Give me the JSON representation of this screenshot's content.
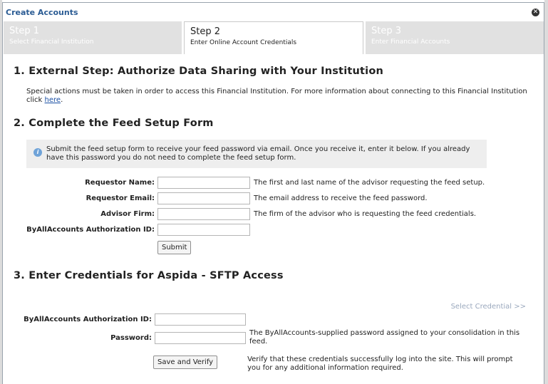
{
  "dialog": {
    "title": "Create Accounts"
  },
  "steps": [
    {
      "num": "Step 1",
      "desc": "Select Financial Institution",
      "active": false
    },
    {
      "num": "Step 2",
      "desc": "Enter Online Account Credentials",
      "active": true
    },
    {
      "num": "Step 3",
      "desc": "Enter Financial Accounts",
      "active": false
    }
  ],
  "section1": {
    "heading": "1. External Step: Authorize Data Sharing with Your Institution",
    "text": "Special actions must be taken in order to access this Financial Institution. For more information about connecting to this Financial Institution click ",
    "link": "here",
    "text_end": "."
  },
  "section2": {
    "heading": "2. Complete the Feed Setup Form",
    "info": "Submit the feed setup form to receive your feed password via email. Once you receive it, enter it below. If you already have this password you do not need to complete the feed setup form.",
    "fields": [
      {
        "label": "Requestor Name:",
        "value": "",
        "help": "The first and last name of the advisor requesting the feed setup."
      },
      {
        "label": "Requestor Email:",
        "value": "",
        "help": "The email address to receive the feed password."
      },
      {
        "label": "Advisor Firm:",
        "value": "",
        "help": "The firm of the advisor who is requesting the feed credentials."
      },
      {
        "label": "ByAllAccounts Authorization ID:",
        "value": "",
        "help": ""
      }
    ],
    "submit_label": "Submit"
  },
  "section3": {
    "heading": "3. Enter Credentials for Aspida - SFTP Access",
    "select_credential": "Select Credential >>",
    "fields": [
      {
        "label": "ByAllAccounts Authorization ID:",
        "value": "",
        "help": ""
      },
      {
        "label": "Password:",
        "value": "",
        "help": "The ByAllAccounts-supplied password assigned to your consolidation in this feed."
      }
    ],
    "save_label": "Save and Verify",
    "save_help": "Verify that these credentials successfully log into the site. This will prompt you for any additional information required."
  }
}
